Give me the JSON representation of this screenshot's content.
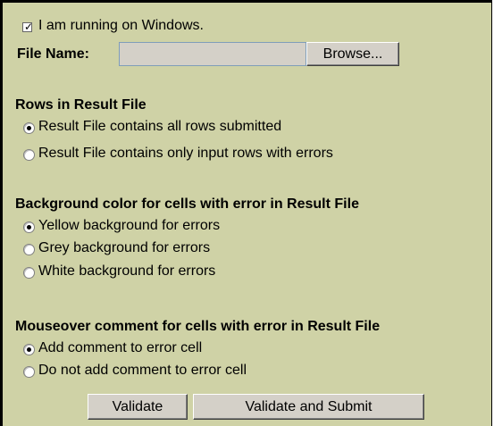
{
  "windows_checkbox": {
    "label": "I am running on Windows.",
    "checked": true
  },
  "file": {
    "label": "File Name:",
    "value": "",
    "browse_label": "Browse..."
  },
  "rows_section": {
    "heading": "Rows in Result File",
    "options": [
      {
        "label": "Result File contains all rows submitted",
        "selected": true
      },
      {
        "label": "Result File contains only input rows with errors",
        "selected": false
      }
    ]
  },
  "bg_section": {
    "heading": "Background color for cells with error in Result File",
    "options": [
      {
        "label": "Yellow background for errors",
        "selected": true
      },
      {
        "label": "Grey background for errors",
        "selected": false
      },
      {
        "label": "White background for errors",
        "selected": false
      }
    ]
  },
  "comment_section": {
    "heading": "Mouseover comment for cells with error in Result File",
    "options": [
      {
        "label": "Add comment to error cell",
        "selected": true
      },
      {
        "label": "Do not add comment to error cell",
        "selected": false
      }
    ]
  },
  "actions": {
    "validate_label": "Validate",
    "validate_submit_label": "Validate and Submit"
  },
  "colors": {
    "panel_background": "#cfd2a6",
    "border": "#000000",
    "button_face": "#d4d0c8"
  }
}
